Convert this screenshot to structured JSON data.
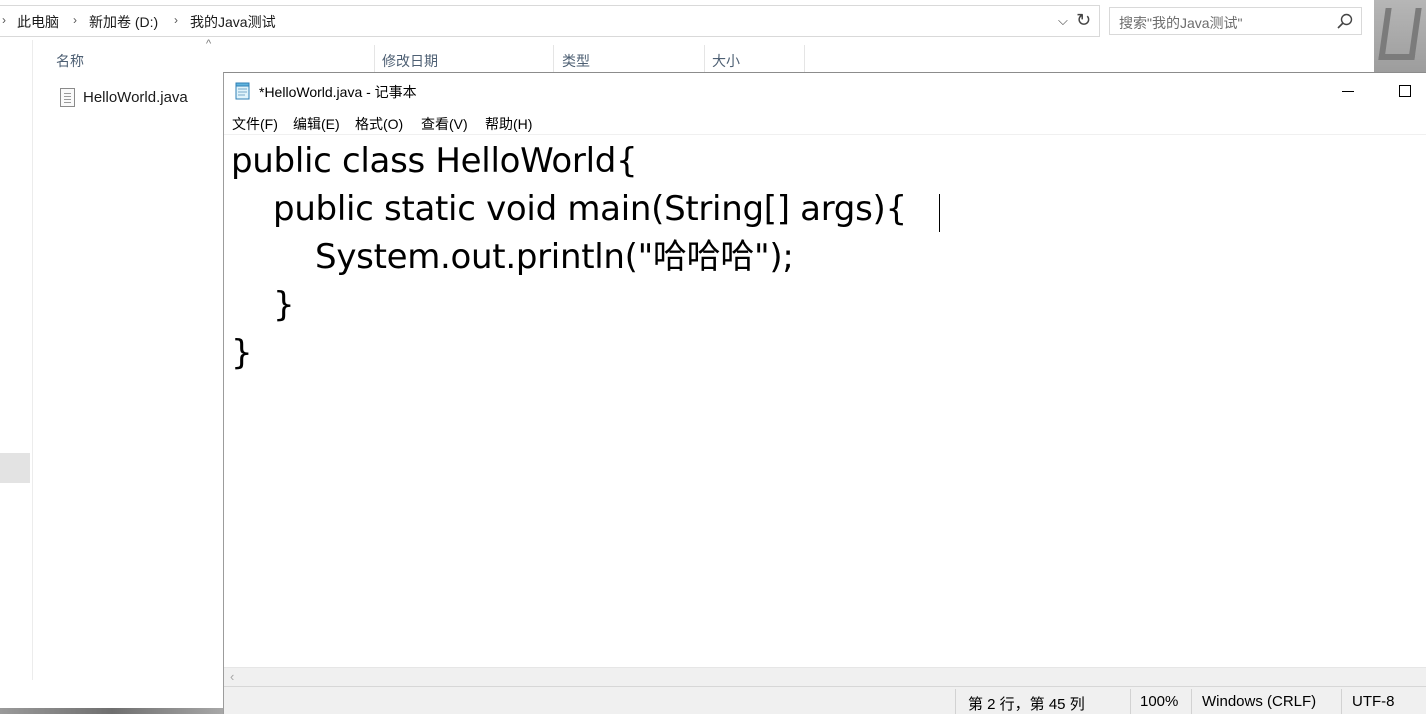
{
  "explorer": {
    "breadcrumb": [
      "此电脑",
      "新加卷 (D:)",
      "我的Java测试"
    ],
    "search_placeholder": "搜索\"我的Java测试\"",
    "columns": [
      "名称",
      "修改日期",
      "类型",
      "大小"
    ],
    "files": [
      {
        "name": "HelloWorld.java",
        "icon": "text-file-icon"
      }
    ]
  },
  "notepad": {
    "title": "*HelloWorld.java - 记事本",
    "menu": [
      "文件(F)",
      "编辑(E)",
      "格式(O)",
      "查看(V)",
      "帮助(H)"
    ],
    "code_lines": [
      "public class HelloWorld{",
      "    public static void main(String[] args){",
      "        System.out.println(\"哈哈哈\");",
      "    }",
      "}"
    ],
    "status": {
      "position": "第 2 行，第 45 列",
      "zoom": "100%",
      "line_ending": "Windows (CRLF)",
      "encoding": "UTF-8"
    }
  }
}
